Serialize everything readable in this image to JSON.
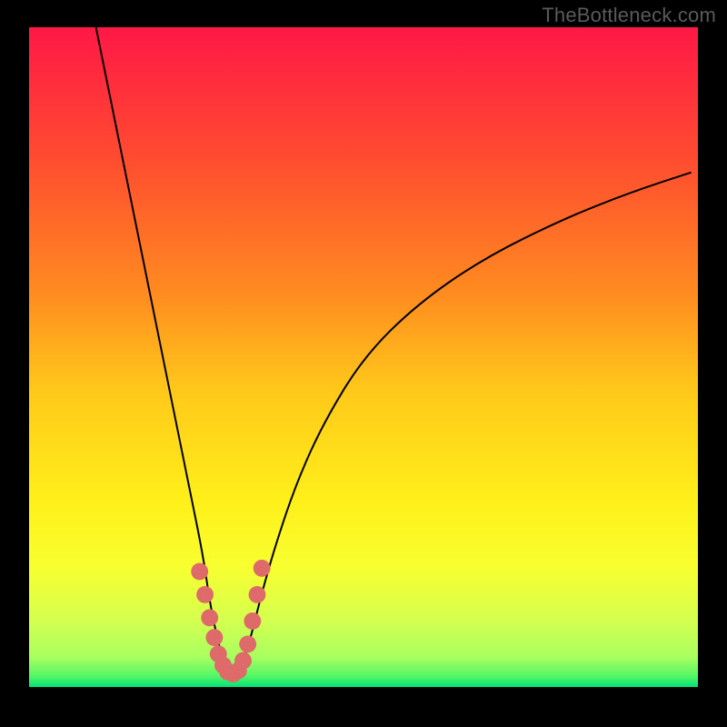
{
  "watermark": "TheBottleneck.com",
  "gradient_stops": [
    {
      "offset": 0,
      "color": "#ff1846"
    },
    {
      "offset": 0.2,
      "color": "#ff4c30"
    },
    {
      "offset": 0.4,
      "color": "#ff8a20"
    },
    {
      "offset": 0.55,
      "color": "#ffc81a"
    },
    {
      "offset": 0.72,
      "color": "#fff01a"
    },
    {
      "offset": 0.82,
      "color": "#f8ff30"
    },
    {
      "offset": 0.9,
      "color": "#d4ff50"
    },
    {
      "offset": 0.955,
      "color": "#a8ff60"
    },
    {
      "offset": 0.985,
      "color": "#50f566"
    },
    {
      "offset": 1.0,
      "color": "#00e07a"
    }
  ],
  "chart_data": {
    "type": "line",
    "title": "",
    "xlabel": "",
    "ylabel": "",
    "xlim": [
      0,
      100
    ],
    "ylim": [
      0,
      100
    ],
    "x_minimum_at": 30,
    "series": [
      {
        "name": "curve",
        "x": [
          10,
          14,
          17,
          20,
          22,
          24,
          26,
          27,
          28,
          29,
          30,
          31,
          32,
          33,
          34,
          35,
          37,
          40,
          44,
          50,
          58,
          68,
          80,
          90,
          99
        ],
        "y_ratio": [
          1.0,
          0.8,
          0.65,
          0.5,
          0.4,
          0.3,
          0.2,
          0.13,
          0.08,
          0.04,
          0.02,
          0.02,
          0.04,
          0.07,
          0.11,
          0.15,
          0.22,
          0.31,
          0.4,
          0.5,
          0.58,
          0.65,
          0.71,
          0.75,
          0.78
        ]
      }
    ],
    "highlight": {
      "name": "bottom-marker",
      "color": "#df6a6a",
      "radius_ratio": 0.013,
      "x": [
        25.5,
        26.3,
        27.0,
        27.7,
        28.3,
        29.0,
        29.7,
        30.5,
        31.3,
        32.0,
        32.7,
        33.4,
        34.1,
        34.8
      ],
      "y_ratio": [
        0.175,
        0.14,
        0.105,
        0.075,
        0.05,
        0.033,
        0.023,
        0.02,
        0.025,
        0.04,
        0.065,
        0.1,
        0.14,
        0.18
      ]
    }
  }
}
